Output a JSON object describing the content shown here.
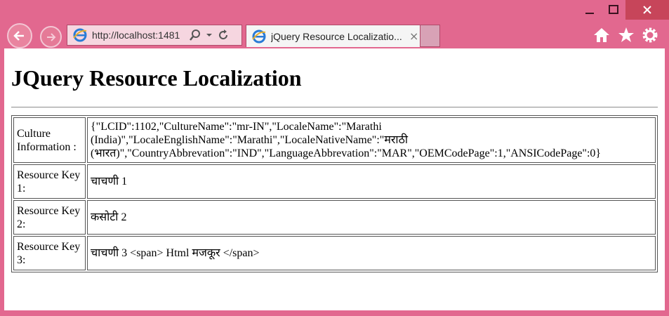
{
  "browser": {
    "url": "http://localhost:1481",
    "tab_title": "jQuery Resource Localizatio...",
    "close_tab_label": "×"
  },
  "page": {
    "heading": "JQuery Resource Localization",
    "rows": [
      {
        "key": "Culture Information :",
        "value": "{\"LCID\":1102,\"CultureName\":\"mr-IN\",\"LocaleName\":\"Marathi (India)\",\"LocaleEnglishName\":\"Marathi\",\"LocaleNativeName\":\"मराठी (भारत)\",\"CountryAbbrevation\":\"IND\",\"LanguageAbbrevation\":\"MAR\",\"OEMCodePage\":1,\"ANSICodePage\":0}"
      },
      {
        "key": "Resource Key 1:",
        "value": "चाचणी 1"
      },
      {
        "key": "Resource Key 2:",
        "value": "कसोटी 2"
      },
      {
        "key": "Resource Key 3:",
        "value": "चाचणी 3 <span> Html मजकूर </span>"
      }
    ]
  }
}
